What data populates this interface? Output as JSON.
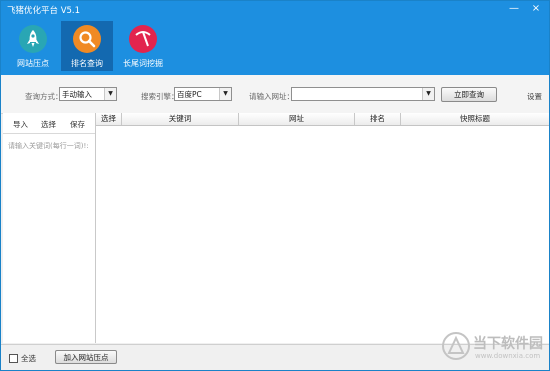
{
  "window": {
    "title": "飞猪优化平台 V5.1",
    "minimize_label": "—",
    "close_label": "×"
  },
  "nav": [
    {
      "label": "网站压点",
      "icon": "rocket-icon"
    },
    {
      "label": "排名查询",
      "icon": "magnifier-icon"
    },
    {
      "label": "长尾词挖掘",
      "icon": "pickaxe-icon"
    }
  ],
  "toolbar": {
    "query_method_label": "查询方式：",
    "query_method_value": "手动输入",
    "engine_label": "搜索引擎：",
    "engine_value": "百度PC",
    "url_label": "请输入网址：",
    "url_value": "",
    "query_button": "立即查询",
    "settings": "设置",
    "dropdown_arrow": "▼"
  },
  "left_panel": {
    "tabs": [
      "导入",
      "选择",
      "保存"
    ],
    "placeholder": "请输入关键词(每行一词)!:"
  },
  "table": {
    "headers": [
      "选择",
      "关键词",
      "网址",
      "排名",
      "快照标题"
    ],
    "rows": []
  },
  "footer": {
    "select_all": "全选",
    "add_button": "加入网站压点"
  },
  "watermark": {
    "text": "当下软件园",
    "url": "www.downxia.com"
  },
  "colors": {
    "header_bg": "#1d8fe0",
    "nav_active_bg": "#1369b0",
    "nav1": "#29a6b4",
    "nav2": "#f08a24",
    "nav3": "#e2244e"
  }
}
